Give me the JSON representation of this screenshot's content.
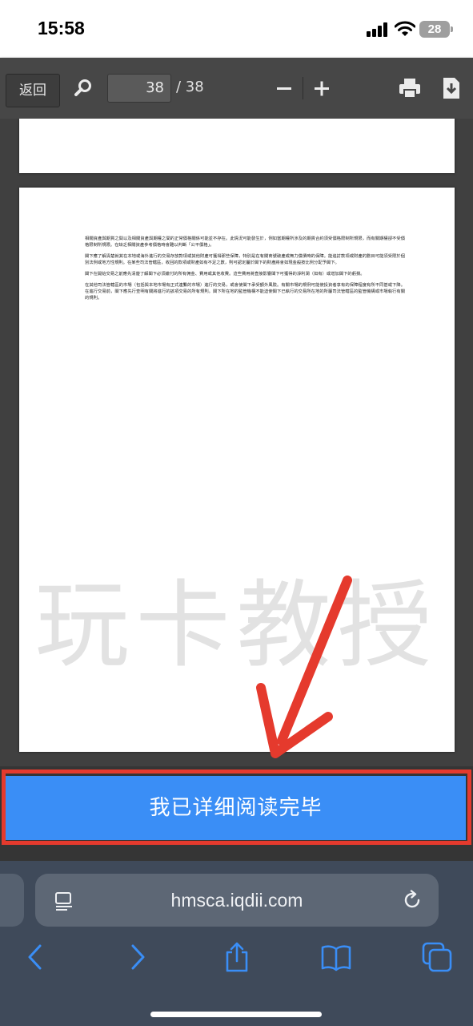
{
  "status_bar": {
    "time": "15:58",
    "battery": "28"
  },
  "toolbar": {
    "back_label": "返回",
    "current_page": "38",
    "total_pages": "/ 38",
    "icons": [
      "search-icon",
      "zoom-out-icon",
      "zoom-in-icon",
      "print-icon",
      "download-icon"
    ]
  },
  "document": {
    "paragraphs": [
      "相關資產與期貨之間以及相關資產與期權之間的正常價格關係可能並不存在。此情況可能發生於，例如當期權所涉及的期貨合約須受價格限制所規限，而有關期權卻不受價格限制所規限。在缺乏相關資產參考價格時會難以判斷「公平價格」。",
      "閣下應了解清楚就其在本地或海外進行的交易存放款項或其他財產可獲得那些保障，特別是在有關商號破產或無力償債時的保障。能追討款項或財產的數目可能須受限於個別法例或地方性規則。在某些司法管轄區，收回的款項或財產如有不足之數，則可認定屬於閣下的財產將會如現金般按比例分配予閣下。",
      "閣下在開始交易之前應先清楚了解閣下必須繳付的所有佣金、費用或其他收費。這些費用將直接影響閣下可獲得的淨利潤（如有）或增加閣下的虧損。",
      "在其他司法管轄區的市場（包括與本地市場有正式連繫的市場）進行的交易，或會使閣下承受額外風險。有關市場的規例可能使投資者享有的保障程度有所不同甚或下降。在進行交易前，閣下應先行查明有關將進行的該項交易的所有規則。閣下所在地的監管機構不能迫使閣下已執行的交易所在地的所屬司法管轄區的監管機構或市場執行有關的規則。"
    ]
  },
  "overlay": {
    "watermark": "玩卡教授",
    "arrow_color": "#e53a2d"
  },
  "confirm": {
    "label": "我已详细阅读完毕",
    "color": "#3a8ef6",
    "highlight_color": "#e53a2d"
  },
  "browser": {
    "url": "hmsca.iqdii.com",
    "nav_icons": [
      "back-icon",
      "forward-icon",
      "share-icon",
      "bookmarks-icon",
      "tabs-icon"
    ]
  }
}
